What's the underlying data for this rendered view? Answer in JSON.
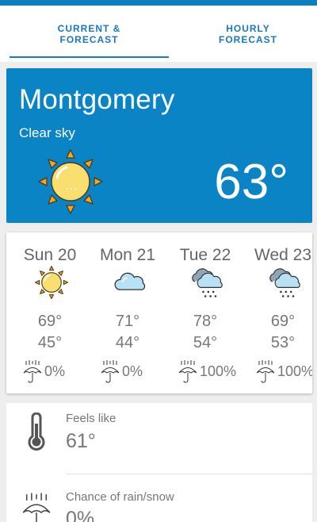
{
  "tabs": [
    {
      "line1": "CURRENT &",
      "line2": "FORECAST"
    },
    {
      "line1": "HOURLY",
      "line2": "FORECAST"
    }
  ],
  "current": {
    "city": "Montgomery",
    "condition": "Clear sky",
    "temperature": "63°",
    "icon": "sun-icon"
  },
  "forecast": [
    {
      "day": "Sun 20",
      "icon": "sun-icon",
      "high": "69°",
      "low": "45°",
      "precip": "0%"
    },
    {
      "day": "Mon 21",
      "icon": "cloud-icon",
      "high": "71°",
      "low": "44°",
      "precip": "0%"
    },
    {
      "day": "Tue 22",
      "icon": "cloud-rain-icon",
      "high": "78°",
      "low": "54°",
      "precip": "100%"
    },
    {
      "day": "Wed 23",
      "icon": "cloud-rain-icon",
      "high": "69°",
      "low": "53°",
      "precip": "100%"
    }
  ],
  "details": {
    "feels_like_label": "Feels like",
    "feels_like_value": "61°",
    "rain_label": "Chance of rain/snow",
    "rain_value": "0%"
  },
  "colors": {
    "accent": "#0b84c6",
    "tab_text": "#1a78c2",
    "sun_fill": "#f8df6f",
    "cloud_fill": "#b9e1f6"
  }
}
